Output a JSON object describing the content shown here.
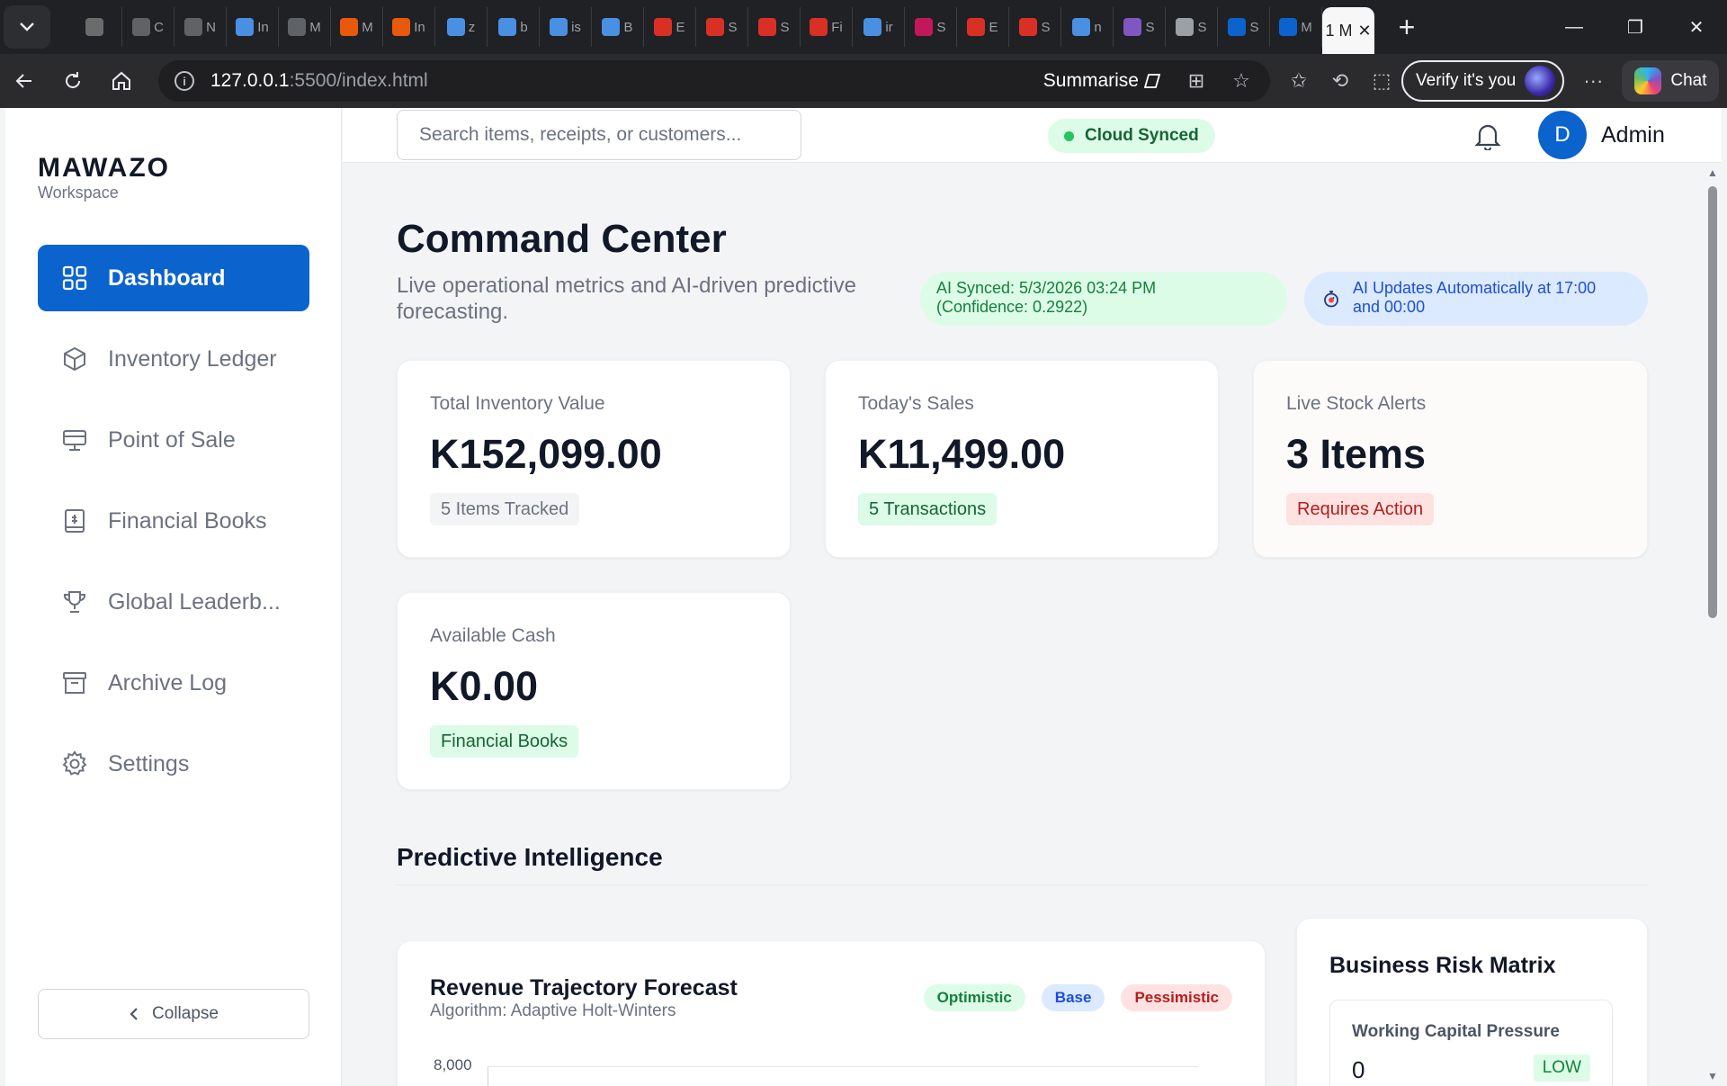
{
  "browser": {
    "mini_tabs": [
      {
        "letter": "",
        "color": "#6b6b6b"
      },
      {
        "letter": "C",
        "color": "#5f6368"
      },
      {
        "letter": "N",
        "color": "#5f6368"
      },
      {
        "letter": "In",
        "color": "#4a90e2"
      },
      {
        "letter": "M",
        "color": "#5f6368"
      },
      {
        "letter": "M",
        "color": "#e8590c"
      },
      {
        "letter": "In",
        "color": "#e8590c"
      },
      {
        "letter": "z",
        "color": "#4a90e2"
      },
      {
        "letter": "b",
        "color": "#4a90e2"
      },
      {
        "letter": "is",
        "color": "#4a90e2"
      },
      {
        "letter": "B",
        "color": "#4a90e2"
      },
      {
        "letter": "E",
        "color": "#d93025"
      },
      {
        "letter": "S",
        "color": "#d93025"
      },
      {
        "letter": "S",
        "color": "#d93025"
      },
      {
        "letter": "Fi",
        "color": "#d93025"
      },
      {
        "letter": "ir",
        "color": "#4a90e2"
      },
      {
        "letter": "S",
        "color": "#c2185b"
      },
      {
        "letter": "E",
        "color": "#d93025"
      },
      {
        "letter": "S",
        "color": "#d93025"
      },
      {
        "letter": "n",
        "color": "#4a90e2"
      },
      {
        "letter": "S",
        "color": "#7e57c2"
      },
      {
        "letter": "S",
        "color": "#9aa0a6"
      },
      {
        "letter": "S",
        "color": "#0b63ce"
      },
      {
        "letter": "M",
        "color": "#0b63ce"
      }
    ],
    "active_tab_label": "1 M",
    "url_host": "127.0.0.1",
    "url_path": ":5500/index.html",
    "summarise_label": "Summarise",
    "verify_label": "Verify it's you",
    "chat_label": "Chat"
  },
  "sidebar": {
    "brand": "MAWAZO",
    "brand_sub": "Workspace",
    "items": [
      {
        "label": "Dashboard",
        "icon": "grid-icon",
        "active": true
      },
      {
        "label": "Inventory Ledger",
        "icon": "box-icon"
      },
      {
        "label": "Point of Sale",
        "icon": "monitor-icon"
      },
      {
        "label": "Financial Books",
        "icon": "book-icon"
      },
      {
        "label": "Global Leaderb...",
        "icon": "trophy-icon"
      },
      {
        "label": "Archive Log",
        "icon": "archive-icon"
      },
      {
        "label": "Settings",
        "icon": "gear-icon"
      }
    ],
    "collapse_label": "Collapse"
  },
  "topbar": {
    "search_placeholder": "Search items, receipts, or customers...",
    "sync_status": "Cloud Synced",
    "avatar_initial": "D",
    "user_name": "Admin"
  },
  "header": {
    "title": "Command Center",
    "subtitle": "Live operational metrics and AI-driven predictive forecasting.",
    "ai_synced_line1": "AI Synced: 5/3/2026 03:24 PM",
    "ai_synced_line2": "(Confidence: 0.2922)",
    "ai_auto_line1": "AI Updates Automatically at 17:00",
    "ai_auto_line2": "and 00:00"
  },
  "stats": [
    {
      "label": "Total Inventory Value",
      "value": "K152,099.00",
      "tag": "5 Items Tracked",
      "tag_style": "gray"
    },
    {
      "label": "Today's Sales",
      "value": "K11,499.00",
      "tag": "5 Transactions",
      "tag_style": "green"
    },
    {
      "label": "Live Stock Alerts",
      "value": "3 Items",
      "tag": "Requires Action",
      "tag_style": "red"
    },
    {
      "label": "Available Cash",
      "value": "K0.00",
      "tag": "Financial Books",
      "tag_style": "green"
    }
  ],
  "predictive": {
    "section_title": "Predictive Intelligence",
    "forecast_title": "Revenue Trajectory Forecast",
    "forecast_sub": "Algorithm: Adaptive Holt-Winters",
    "legend": [
      "Optimistic",
      "Base",
      "Pessimistic"
    ],
    "y_tick_top": "8,000",
    "risk_title": "Business Risk Matrix",
    "risk_items": [
      {
        "label": "Working Capital Pressure",
        "value": "0",
        "level": "LOW"
      }
    ]
  }
}
